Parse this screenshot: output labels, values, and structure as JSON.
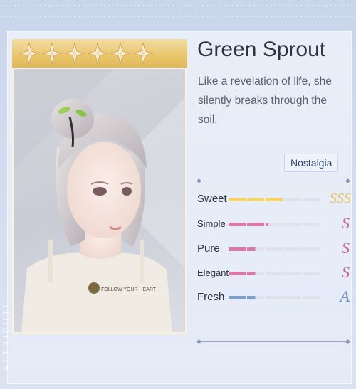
{
  "item": {
    "name": "Green Sprout",
    "description": "Like a revelation of life, she silently breaks through the soil.",
    "tag": "Nostalgia",
    "rarity_stars": 6,
    "shirt_print": "FOLLOW YOUR HEART"
  },
  "side_label": "ATTRIBUTE",
  "attributes": [
    {
      "name": "Sweet",
      "grade": "SSS",
      "level": 0.6,
      "bar_color": "#f3d36b",
      "grade_color": "#e9c25a"
    },
    {
      "name": "Simple",
      "grade": "S",
      "level": 0.43,
      "bar_color": "#d97aab",
      "grade_color": "#c7629a"
    },
    {
      "name": "Pure",
      "grade": "S",
      "level": 0.29,
      "bar_color": "#d97aab",
      "grade_color": "#c7629a"
    },
    {
      "name": "Elegant",
      "grade": "S",
      "level": 0.29,
      "bar_color": "#d97aab",
      "grade_color": "#c7629a"
    },
    {
      "name": "Fresh",
      "grade": "A",
      "level": 0.29,
      "bar_color": "#7ea0cf",
      "grade_color": "#6f8fc2"
    }
  ],
  "colors": {
    "background": "#d3dcef",
    "panel": "#e8eef8",
    "card_header_gold": "#e9c66b",
    "title_text": "#2e3440"
  },
  "icons": [
    "star-icon",
    "gem-icon"
  ]
}
